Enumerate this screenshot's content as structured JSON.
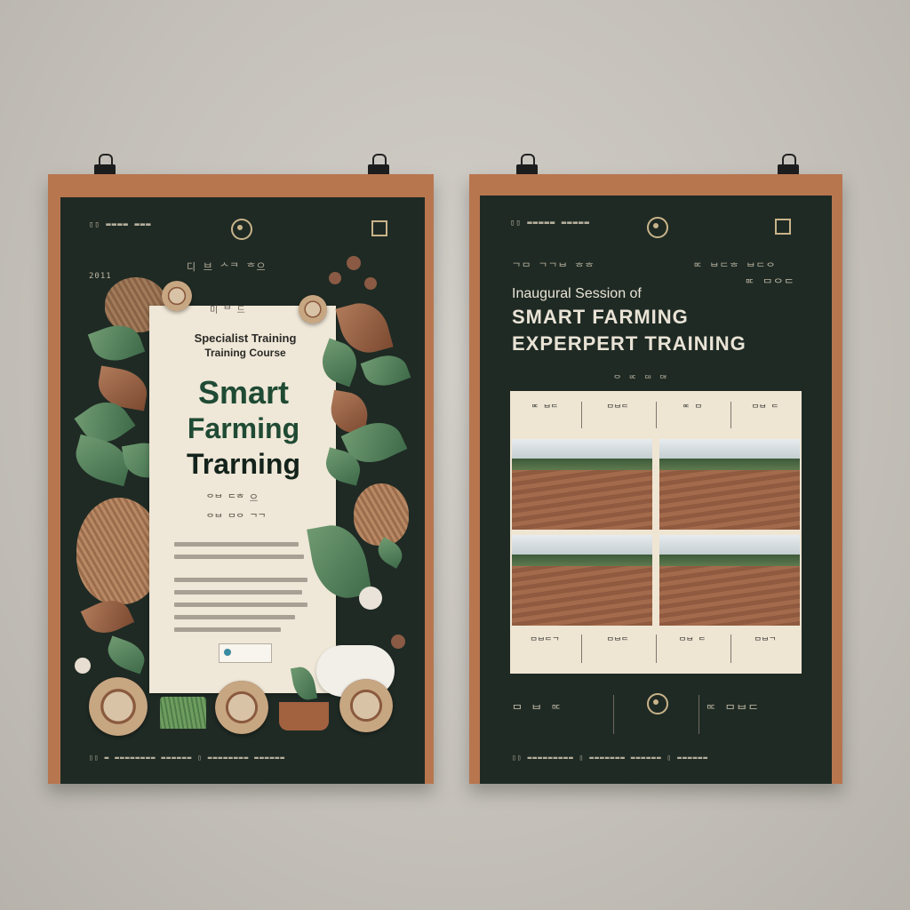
{
  "left_poster": {
    "corner_year": "2011",
    "header_glyphs": "디 브 ᄉᄏ ᄒ으",
    "paper_glyphs_top": "미 ᄇ 드",
    "subtitle_line1": "Specialist Training",
    "subtitle_line2": "Training Course",
    "title_line1": "Smart",
    "title_line2": "Farming",
    "title_line3": "Trarning",
    "small_glyphs_1": "ᄋᄇ ᄃᄒ 으",
    "small_glyphs_2": "ᄋᄇ ᄆᄋ ᄀᄀ"
  },
  "right_poster": {
    "header_glyphs": "ᄀᄆ ᄀᄀᄇ ᄒᄒ",
    "header_glyphs_right": "ᄆᄃ ᄇᄃᄒ ᄇᄃᄋ",
    "side_glyphs": "ᄆᄃ ᄆᄋᄃ",
    "title_line1": "Inaugural Session of",
    "title_line2": "SMART FARMING",
    "title_line3": "EXPERPERT TRAINING",
    "under_title_glyphs": "ᄋ ᄆᄃ ᄃᄆ ᄃᄇ",
    "panel_labels_top": [
      "ᄆᄃ ᄇᄃ",
      "ᄆᄇᄃ",
      "ᄆᄃ ᄆ",
      "ᄆᄇ ᄃ"
    ],
    "panel_labels_bottom": [
      "ᄆᄇᄃᄀ",
      "ᄆᄇᄃ",
      "ᄆᄇ ᄃ",
      "ᄆᄇᄀ"
    ],
    "footer_left_glyphs": "ᄆ ᄇ ᄆᄃ",
    "footer_right_glyphs": "ᄆᄃ ᄆᄇᄃ"
  }
}
